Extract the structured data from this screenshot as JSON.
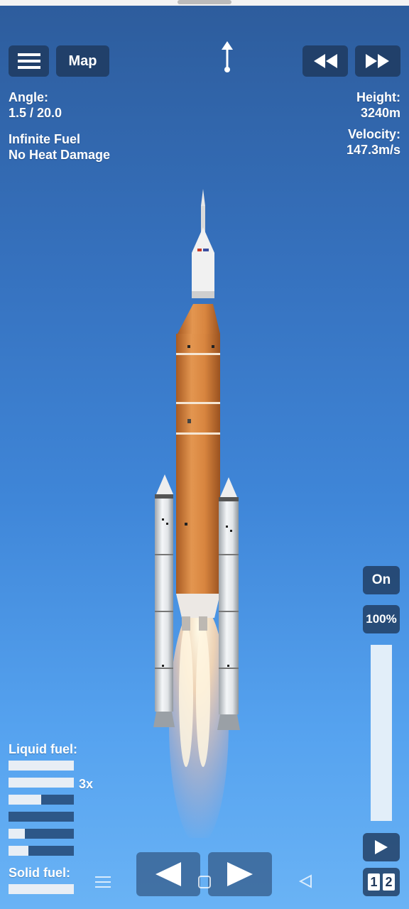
{
  "toolbar": {
    "menu_icon": "hamburger-menu-icon",
    "map_label": "Map",
    "direction_icon": "arrow-up-direction-icon",
    "rewind_icon": "rewind-icon",
    "fast_forward_icon": "fast-forward-icon"
  },
  "telemetry": {
    "angle_label": "Angle:",
    "angle_value": "1.5 / 20.0",
    "cheat_1": "Infinite Fuel",
    "cheat_2": "No Heat Damage",
    "height_label": "Height:",
    "height_value": "3240m",
    "velocity_label": "Velocity:",
    "velocity_value": "147.3m/s"
  },
  "fuel": {
    "liquid_label": "Liquid fuel:",
    "multiplier": "3x",
    "liquid_levels": [
      1.0,
      1.0,
      0.5,
      0.0,
      0.25,
      0.3
    ],
    "solid_label": "Solid fuel:",
    "solid_levels": [
      1.0
    ]
  },
  "engine": {
    "toggle_label": "On",
    "throttle_label": "100%",
    "throttle_level": 1.0,
    "play_icon": "play-icon"
  },
  "stage": {
    "digit_1": "1",
    "digit_2": "2"
  },
  "controls": {
    "rotate_left_icon": "triangle-left-icon",
    "rotate_right_icon": "triangle-right-icon"
  },
  "system_nav": {
    "recents_icon": "menu-lines-icon",
    "home_icon": "square-icon",
    "back_icon": "back-triangle-icon"
  },
  "colors": {
    "sky_top": "#2d5c9c",
    "sky_bottom": "#6ab3f5",
    "core_stage": "#d8853f",
    "button_bg": "#1e375a"
  }
}
